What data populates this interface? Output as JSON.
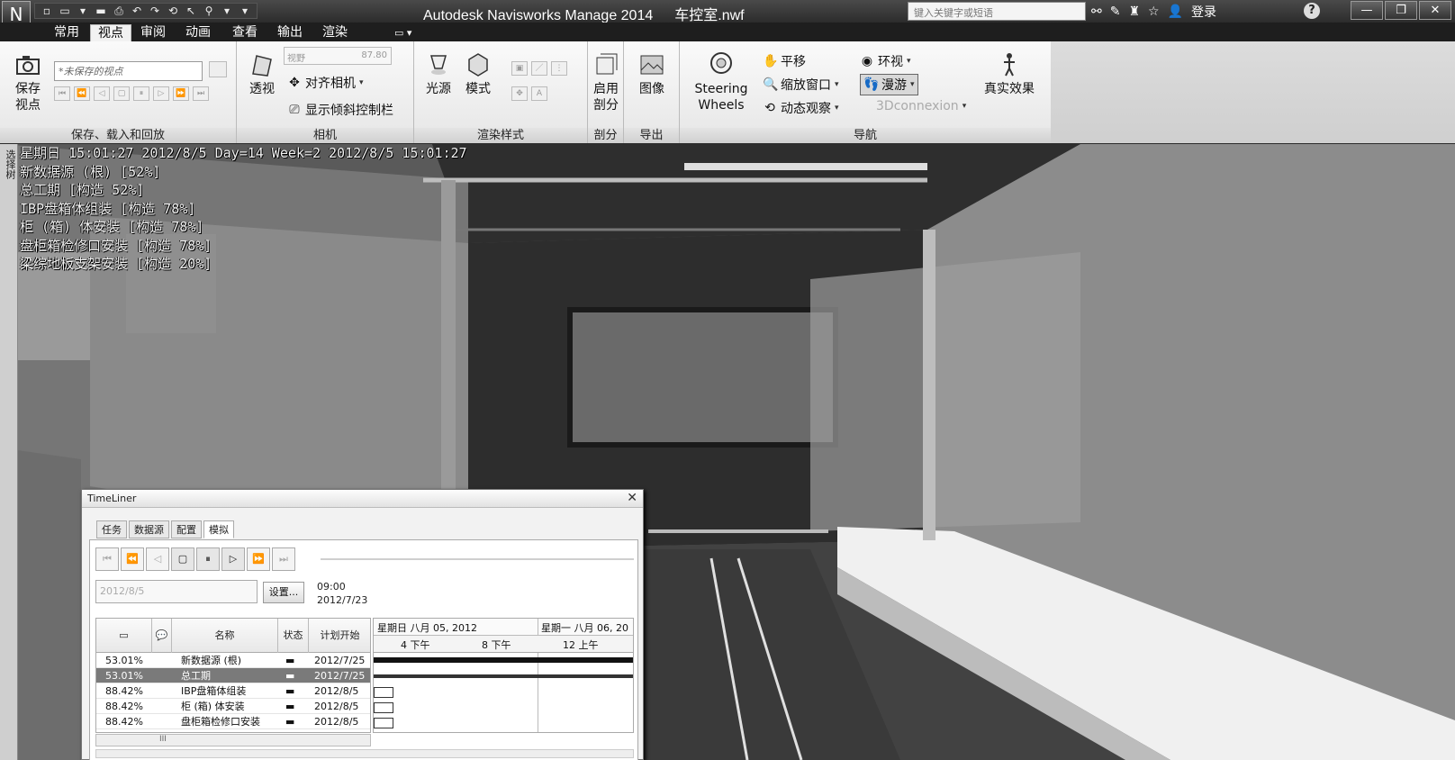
{
  "window": {
    "app_menu_glyph": "N",
    "title": "Autodesk Navisworks Manage 2014",
    "file": "车控室.nwf",
    "search_placeholder": "键入关键字或短语",
    "login": "登录",
    "help": "?",
    "controls": [
      "—",
      "❐",
      "✕"
    ]
  },
  "qat": [
    "▫",
    "▭",
    "▾",
    "▬",
    "⎙",
    "↶",
    "↷",
    "⟲",
    "↖",
    "⚲",
    "▾",
    "▾"
  ],
  "top_tools": [
    "⚯",
    "✎",
    "♜",
    "☆",
    "👤"
  ],
  "tabs": [
    "常用",
    "视点",
    "审阅",
    "动画",
    "查看",
    "输出",
    "渲染"
  ],
  "active_tab": "视点",
  "tab_extra": "▭ ▾",
  "ribbon": {
    "save": {
      "save_viewpoint": "保存视点",
      "combo": "*未保存的视点",
      "title": "保存、载入和回放"
    },
    "camera": {
      "perspective": "透视",
      "fov_label": "视野",
      "fov_value": "87.80",
      "align_camera": "对齐相机",
      "show_tilt": "显示倾斜控制栏",
      "title": "相机"
    },
    "render_style": {
      "light": "光源",
      "mode": "模式",
      "title": "渲染样式"
    },
    "sectioning": {
      "enable": "启用剖分",
      "title": "剖分"
    },
    "export": {
      "image": "图像",
      "title": "导出"
    },
    "navigation": {
      "steering": "Steering Wheels",
      "pan": "平移",
      "zoom_window": "缩放窗口",
      "orbit": "动态观察",
      "look_around": "环视",
      "walk": "漫游",
      "connexion": "3Dconnexion",
      "realism": "真实效果",
      "title": "导航"
    }
  },
  "sidebar_label": "选择树",
  "hud_lines": [
    "星期日 15:01:27 2012/8/5 Day=14 Week=2 2012/8/5 15:01:27",
    "新数据源 (根) [52%]",
    "总工期 [构造 52%]",
    "IBP盘箱体组装 [构造 78%]",
    "柜 (箱) 体安装 [构造 78%]",
    "盘柜箱检修口安装 [构造 78%]",
    "梁综地板支架安装 [构造 20%]"
  ],
  "timeliner": {
    "title": "TimeLiner",
    "tabs": [
      "任务",
      "数据源",
      "配置",
      "模拟"
    ],
    "active_tab": "模拟",
    "playback": [
      "⏮",
      "⏪",
      "◁",
      "▢",
      "⏸",
      "▷",
      "⏩",
      "⏭"
    ],
    "date_field": "2012/8/5",
    "settings_button": "设置...",
    "time_line1": "09:00",
    "time_line2": "2012/7/23",
    "columns": [
      "▭",
      "💬",
      "名称",
      "状态",
      "计划开始"
    ],
    "rows": [
      {
        "pct": "53.01%",
        "name": "新数据源 (根)",
        "status": "▬",
        "start": "2012/7/25",
        "selected": false
      },
      {
        "pct": "53.01%",
        "name": "总工期",
        "status": "▬",
        "start": "2012/7/25",
        "selected": true
      },
      {
        "pct": "88.42%",
        "name": "IBP盘箱体组装",
        "status": "▬",
        "start": "2012/8/5",
        "selected": false
      },
      {
        "pct": "88.42%",
        "name": "柜 (箱) 体安装",
        "status": "▬",
        "start": "2012/8/5",
        "selected": false
      },
      {
        "pct": "88.42%",
        "name": "盘柜箱检修口安装",
        "status": "▬",
        "start": "2012/8/5",
        "selected": false
      }
    ],
    "gantt_day1": "星期日 八月 05, 2012",
    "gantt_day2": "星期一 八月 06, 20",
    "gantt_hours": [
      "4 下午",
      "8 下午",
      "12 上午"
    ],
    "h_scroll_label": "III"
  },
  "colors": {
    "title_bar": "#2c2c2c",
    "ribbon_bg": "#f2f2f2",
    "hud_text": "#f2f2f2",
    "viewport_dark": "#2a2a2a"
  }
}
